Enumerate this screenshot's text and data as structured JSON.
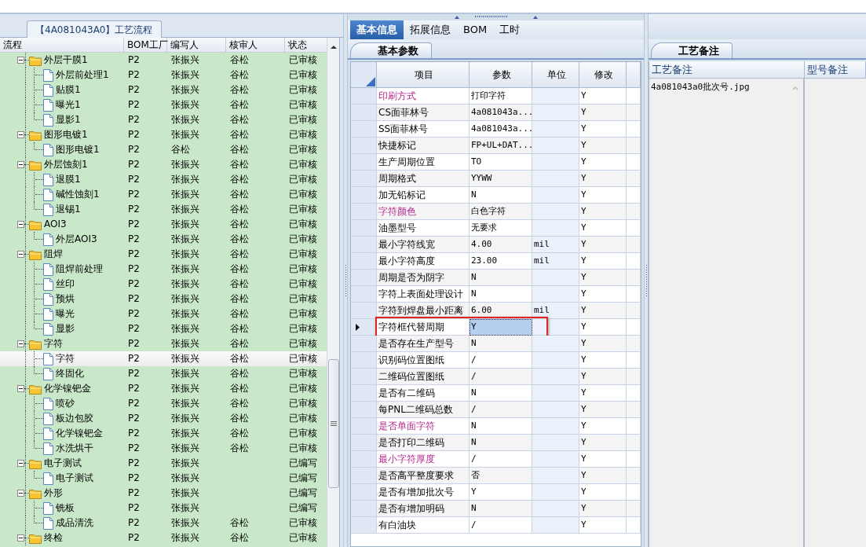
{
  "flow_tab": "【4A081043A0】工艺流程",
  "tree": {
    "columns": [
      "流程",
      "BOM工厂",
      "编写人",
      "核审人",
      "状态"
    ],
    "rows": [
      {
        "name": "外层干膜1",
        "bom": "P2",
        "writer": "张振兴",
        "reviewer": "谷松",
        "status": "已审核",
        "expanded": true,
        "selected": false,
        "children": [
          {
            "name": "外层前处理1",
            "bom": "P2",
            "writer": "张振兴",
            "reviewer": "谷松",
            "status": "已审核",
            "selected": false
          },
          {
            "name": "贴膜1",
            "bom": "P2",
            "writer": "张振兴",
            "reviewer": "谷松",
            "status": "已审核",
            "selected": false
          },
          {
            "name": "曝光1",
            "bom": "P2",
            "writer": "张振兴",
            "reviewer": "谷松",
            "status": "已审核",
            "selected": false
          },
          {
            "name": "显影1",
            "bom": "P2",
            "writer": "张振兴",
            "reviewer": "谷松",
            "status": "已审核",
            "selected": false
          }
        ]
      },
      {
        "name": "图形电镀1",
        "bom": "P2",
        "writer": "张振兴",
        "reviewer": "谷松",
        "status": "已审核",
        "expanded": true,
        "selected": false,
        "children": [
          {
            "name": "图形电镀1",
            "bom": "P2",
            "writer": "谷松",
            "reviewer": "谷松",
            "status": "已审核",
            "selected": false
          }
        ]
      },
      {
        "name": "外层蚀刻1",
        "bom": "P2",
        "writer": "张振兴",
        "reviewer": "谷松",
        "status": "已审核",
        "expanded": true,
        "selected": false,
        "children": [
          {
            "name": "退膜1",
            "bom": "P2",
            "writer": "张振兴",
            "reviewer": "谷松",
            "status": "已审核",
            "selected": false
          },
          {
            "name": "碱性蚀刻1",
            "bom": "P2",
            "writer": "张振兴",
            "reviewer": "谷松",
            "status": "已审核",
            "selected": false
          },
          {
            "name": "退锡1",
            "bom": "P2",
            "writer": "张振兴",
            "reviewer": "谷松",
            "status": "已审核",
            "selected": false
          }
        ]
      },
      {
        "name": "AOI3",
        "bom": "P2",
        "writer": "张振兴",
        "reviewer": "谷松",
        "status": "已审核",
        "expanded": true,
        "selected": false,
        "children": [
          {
            "name": "外层AOI3",
            "bom": "P2",
            "writer": "张振兴",
            "reviewer": "谷松",
            "status": "已审核",
            "selected": false
          }
        ]
      },
      {
        "name": "阻焊",
        "bom": "P2",
        "writer": "张振兴",
        "reviewer": "谷松",
        "status": "已审核",
        "expanded": true,
        "selected": false,
        "children": [
          {
            "name": "阻焊前处理",
            "bom": "P2",
            "writer": "张振兴",
            "reviewer": "谷松",
            "status": "已审核",
            "selected": false
          },
          {
            "name": "丝印",
            "bom": "P2",
            "writer": "张振兴",
            "reviewer": "谷松",
            "status": "已审核",
            "selected": false
          },
          {
            "name": "预烘",
            "bom": "P2",
            "writer": "张振兴",
            "reviewer": "谷松",
            "status": "已审核",
            "selected": false
          },
          {
            "name": "曝光",
            "bom": "P2",
            "writer": "张振兴",
            "reviewer": "谷松",
            "status": "已审核",
            "selected": false
          },
          {
            "name": "显影",
            "bom": "P2",
            "writer": "张振兴",
            "reviewer": "谷松",
            "status": "已审核",
            "selected": false
          }
        ]
      },
      {
        "name": "字符",
        "bom": "P2",
        "writer": "张振兴",
        "reviewer": "谷松",
        "status": "已审核",
        "expanded": true,
        "selected": false,
        "children": [
          {
            "name": "字符",
            "bom": "P2",
            "writer": "张振兴",
            "reviewer": "谷松",
            "status": "已审核",
            "selected": true
          },
          {
            "name": "终固化",
            "bom": "P2",
            "writer": "张振兴",
            "reviewer": "谷松",
            "status": "已审核",
            "selected": false
          }
        ]
      },
      {
        "name": "化学镍钯金",
        "bom": "P2",
        "writer": "张振兴",
        "reviewer": "谷松",
        "status": "已审核",
        "expanded": true,
        "selected": false,
        "children": [
          {
            "name": "喷砂",
            "bom": "P2",
            "writer": "张振兴",
            "reviewer": "谷松",
            "status": "已审核",
            "selected": false
          },
          {
            "name": "板边包胶",
            "bom": "P2",
            "writer": "张振兴",
            "reviewer": "谷松",
            "status": "已审核",
            "selected": false
          },
          {
            "name": "化学镍钯金",
            "bom": "P2",
            "writer": "张振兴",
            "reviewer": "谷松",
            "status": "已审核",
            "selected": false
          },
          {
            "name": "水洗烘干",
            "bom": "P2",
            "writer": "张振兴",
            "reviewer": "谷松",
            "status": "已审核",
            "selected": false
          }
        ]
      },
      {
        "name": "电子测试",
        "bom": "P2",
        "writer": "张振兴",
        "status": "已编写",
        "expanded": true,
        "selected": false,
        "children": [
          {
            "name": "电子测试",
            "bom": "P2",
            "writer": "张振兴",
            "status": "已编写",
            "selected": false
          }
        ]
      },
      {
        "name": "外形",
        "bom": "P2",
        "writer": "张振兴",
        "status": "已编写",
        "expanded": true,
        "selected": false,
        "children": [
          {
            "name": "铣板",
            "bom": "P2",
            "writer": "张振兴",
            "status": "已编写",
            "selected": false
          },
          {
            "name": "成品清洗",
            "bom": "P2",
            "writer": "张振兴",
            "reviewer": "谷松",
            "status": "已审核",
            "selected": false
          }
        ]
      },
      {
        "name": "终检",
        "bom": "P2",
        "writer": "张振兴",
        "reviewer": "谷松",
        "status": "已审核",
        "expanded": true,
        "selected": false
      }
    ]
  },
  "tabs": [
    {
      "label": "基本信息",
      "selected": true
    },
    {
      "label": "拓展信息",
      "selected": false
    },
    {
      "label": "BOM",
      "selected": false
    },
    {
      "label": "工时",
      "selected": false
    }
  ],
  "params_tab": "基本参数",
  "params": {
    "columns": [
      "项目",
      "参数",
      "单位",
      "修改"
    ],
    "rows": [
      {
        "item": "印刷方式",
        "value": "打印字符",
        "modify": "Y",
        "emphasis": true,
        "selected": false
      },
      {
        "item": "CS面菲林号",
        "value": "4a081043a...",
        "modify": "Y",
        "emphasis": false,
        "selected": false
      },
      {
        "item": "SS面菲林号",
        "value": "4a081043a...",
        "modify": "Y",
        "emphasis": false,
        "selected": false
      },
      {
        "item": "快捷标记",
        "value": "FP+UL+DAT...",
        "modify": "Y",
        "emphasis": false,
        "selected": false
      },
      {
        "item": "生产周期位置",
        "value": "TO",
        "modify": "Y",
        "emphasis": false,
        "selected": false
      },
      {
        "item": "周期格式",
        "value": "YYWW",
        "modify": "Y",
        "emphasis": false,
        "selected": false
      },
      {
        "item": "加无铅标记",
        "value": "N",
        "modify": "Y",
        "emphasis": false,
        "selected": false
      },
      {
        "item": "字符颜色",
        "value": "白色字符",
        "modify": "Y",
        "emphasis": true,
        "selected": false
      },
      {
        "item": "油墨型号",
        "value": "无要求",
        "modify": "Y",
        "emphasis": false,
        "selected": false
      },
      {
        "item": "最小字符线宽",
        "value": "4.00",
        "unit": "mil",
        "modify": "Y",
        "emphasis": false,
        "selected": false
      },
      {
        "item": "最小字符高度",
        "value": "23.00",
        "unit": "mil",
        "modify": "Y",
        "emphasis": false,
        "selected": false
      },
      {
        "item": "周期是否为阴字",
        "value": "N",
        "modify": "Y",
        "emphasis": false,
        "selected": false
      },
      {
        "item": "字符上表面处理设计",
        "value": "N",
        "modify": "Y",
        "emphasis": false,
        "selected": false
      },
      {
        "item": "字符到焊盘最小距离",
        "value": "6.00",
        "unit": "mil",
        "modify": "Y",
        "emphasis": false,
        "selected": false
      },
      {
        "item": "字符框代替周期",
        "value": "Y",
        "modify": "Y",
        "emphasis": false,
        "selected": true,
        "boxed": true
      },
      {
        "item": "是否存在生产型号",
        "value": "N",
        "modify": "Y",
        "emphasis": false,
        "selected": false
      },
      {
        "item": "识别码位置图纸",
        "value": "/",
        "modify": "Y",
        "emphasis": false,
        "selected": false
      },
      {
        "item": "二维码位置图纸",
        "value": "/",
        "modify": "Y",
        "emphasis": false,
        "selected": false
      },
      {
        "item": "是否有二维码",
        "value": "N",
        "modify": "Y",
        "emphasis": false,
        "selected": false
      },
      {
        "item": "每PNL二维码总数",
        "value": "/",
        "modify": "Y",
        "emphasis": false,
        "selected": false
      },
      {
        "item": "是否单面字符",
        "value": "N",
        "modify": "Y",
        "emphasis": true,
        "selected": false
      },
      {
        "item": "是否打印二维码",
        "value": "N",
        "modify": "Y",
        "emphasis": false,
        "selected": false
      },
      {
        "item": "最小字符厚度",
        "value": "/",
        "modify": "Y",
        "emphasis": true,
        "selected": false
      },
      {
        "item": "是否高平整度要求",
        "value": "否",
        "modify": "Y",
        "emphasis": false,
        "selected": false
      },
      {
        "item": "是否有增加批次号",
        "value": "Y",
        "modify": "Y",
        "emphasis": false,
        "selected": false
      },
      {
        "item": "是否有增加明码",
        "value": "N",
        "modify": "Y",
        "emphasis": false,
        "selected": false
      },
      {
        "item": "有白油块",
        "value": "/",
        "modify": "Y",
        "emphasis": false,
        "selected": false
      }
    ]
  },
  "remarks_tab": "工艺备注",
  "remarks": {
    "columns": [
      "工艺备注",
      "型号备注"
    ],
    "text": "4a081043a0批次号.jpg"
  }
}
